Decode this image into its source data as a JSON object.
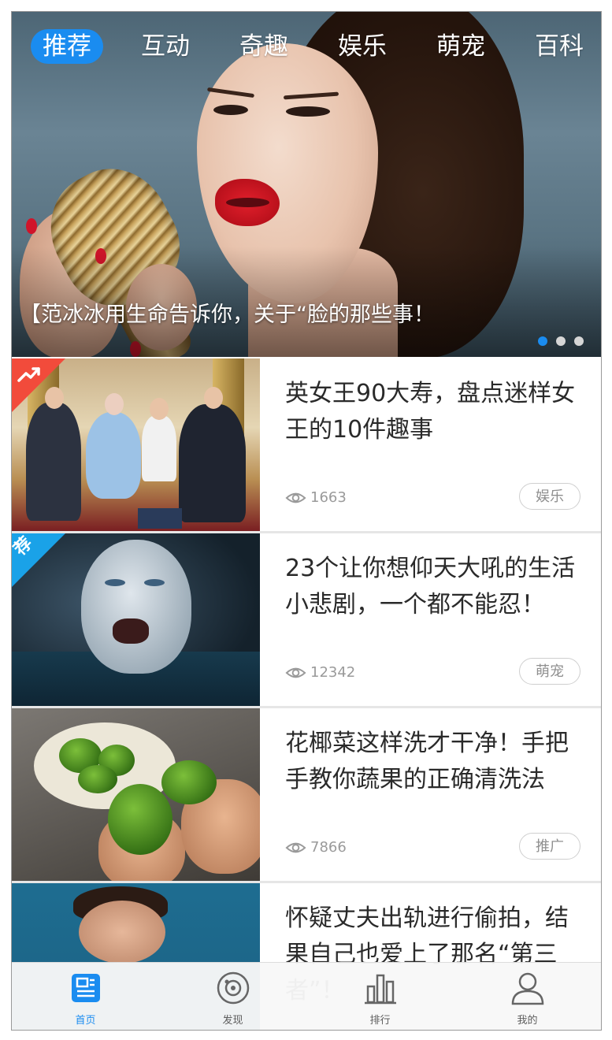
{
  "tabs": [
    {
      "label": "推荐",
      "active": true
    },
    {
      "label": "互动",
      "active": false
    },
    {
      "label": "奇趣",
      "active": false
    },
    {
      "label": "娱乐",
      "active": false
    },
    {
      "label": "萌宠",
      "active": false
    },
    {
      "label": "百科",
      "active": false
    }
  ],
  "banner": {
    "caption": "【范冰冰用生命告诉你，关于“脸的那些事！",
    "page_count": 3,
    "current_page": 1
  },
  "articles": [
    {
      "title": "英女王90大寿，盘点迷样女王的10件趣事",
      "views": "1663",
      "category": "娱乐",
      "badge": "trending-icon",
      "badge_color": "#f24b3b"
    },
    {
      "title": "23个让你想仰天大吼的生活小悲剧，一个都不能忍！",
      "views": "12342",
      "category": "萌宠",
      "badge": "荐",
      "badge_color": "#1aa2e8"
    },
    {
      "title": "花椰菜这样洗才干净！手把手教你蔬果的正确清洗法",
      "views": "7866",
      "category": "推广"
    },
    {
      "title": "怀疑丈夫出轨进行偷拍，结果自己也爱上了那名“第三者”！",
      "views": "",
      "category": ""
    }
  ],
  "bottom_nav": [
    {
      "label": "首页",
      "icon": "news-icon",
      "active": true
    },
    {
      "label": "发现",
      "icon": "discover-icon",
      "active": false
    },
    {
      "label": "排行",
      "icon": "ranking-icon",
      "active": false
    },
    {
      "label": "我的",
      "icon": "user-icon",
      "active": false
    }
  ],
  "colors": {
    "accent": "#1a8cf0",
    "hot_ribbon": "#f24b3b",
    "rec_ribbon": "#1aa2e8"
  }
}
